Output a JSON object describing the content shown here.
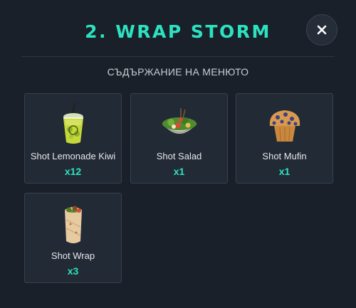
{
  "modal": {
    "title": "2. WRAP STORM",
    "subtitle": "СЪДЪРЖАНИЕ НА МЕНЮТО",
    "close_icon": "close-icon"
  },
  "items": [
    {
      "name": "Shot Lemonade Kiwi",
      "qty": "x12",
      "icon": "lemonade-cup-icon"
    },
    {
      "name": "Shot Salad",
      "qty": "x1",
      "icon": "salad-bowl-icon"
    },
    {
      "name": "Shot Mufin",
      "qty": "x1",
      "icon": "muffin-icon"
    },
    {
      "name": "Shot Wrap",
      "qty": "x3",
      "icon": "wrap-icon"
    }
  ],
  "colors": {
    "accent": "#2de2c0",
    "background": "#1a2029",
    "card": "#222a35",
    "card_border": "#384150"
  }
}
